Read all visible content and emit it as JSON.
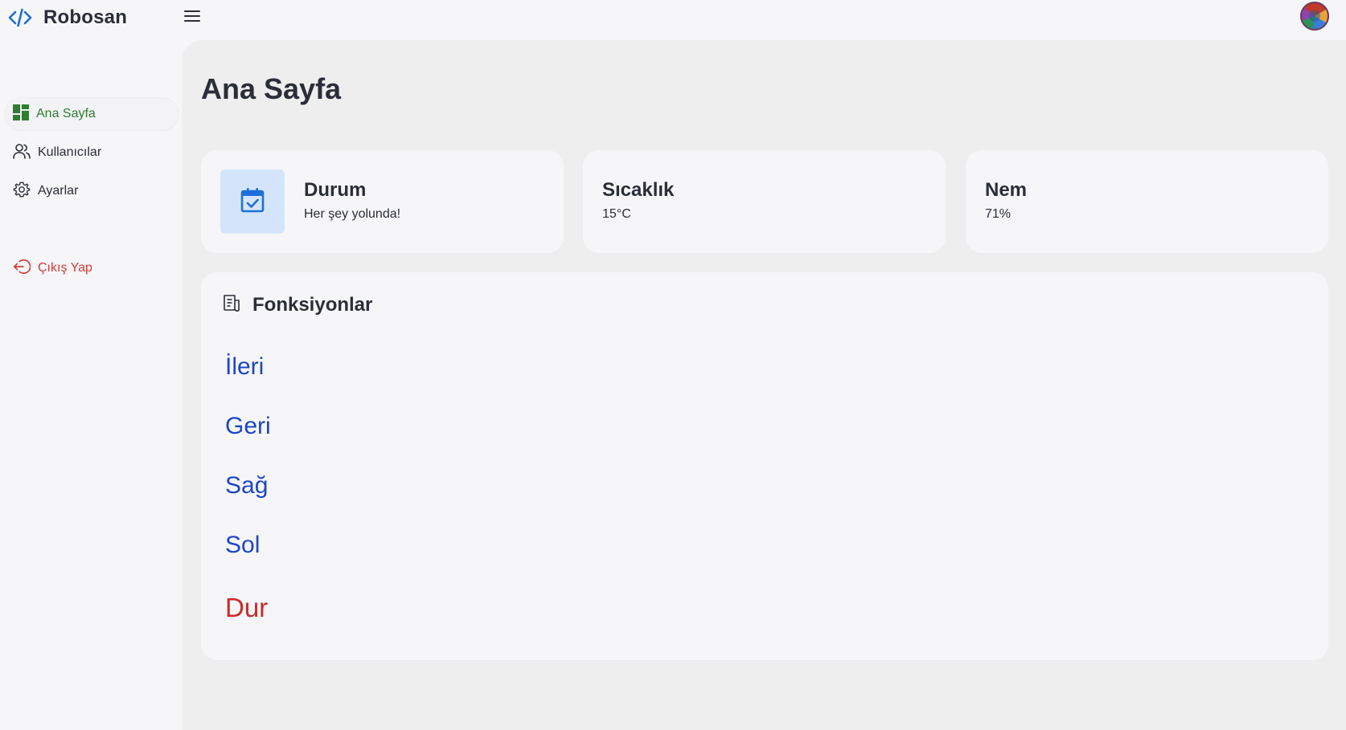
{
  "header": {
    "brand_name": "Robosan",
    "brand_icon": "code-icon",
    "menu_icon": "hamburger-menu-icon"
  },
  "sidebar": {
    "items": [
      {
        "label": "Ana Sayfa",
        "icon": "dashboard-icon",
        "active": true
      },
      {
        "label": "Kullanıcılar",
        "icon": "users-icon",
        "active": false
      },
      {
        "label": "Ayarlar",
        "icon": "gear-icon",
        "active": false
      }
    ],
    "logout": {
      "label": "Çıkış Yap",
      "icon": "logout-icon"
    }
  },
  "main": {
    "page_title": "Ana Sayfa",
    "cards": [
      {
        "title": "Durum",
        "subtitle": "Her şey yolunda!",
        "icon": "calendar-check-icon"
      },
      {
        "title": "Sıcaklık",
        "subtitle": "15°C"
      },
      {
        "title": "Nem",
        "subtitle": "71%"
      }
    ],
    "functions": {
      "title": "Fonksiyonlar",
      "icon": "document-list-icon",
      "actions": [
        "İleri",
        "Geri",
        "Sağ",
        "Sol",
        "Dur"
      ]
    }
  },
  "colors": {
    "accent_green": "#2e7d32",
    "brand_blue": "#1e6fd9",
    "link_blue": "#1e45c8",
    "danger_red": "#cc2a2a",
    "page_bg": "#f6f6f8",
    "panel_bg": "#eeeeef"
  }
}
